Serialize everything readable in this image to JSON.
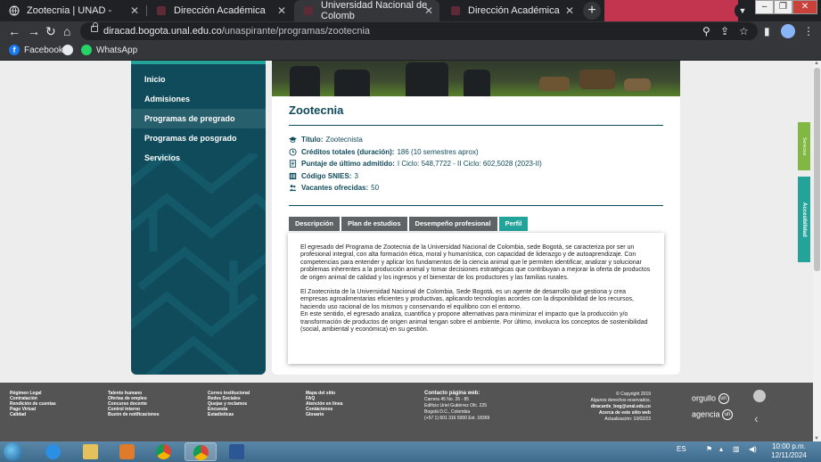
{
  "browser": {
    "tabs": [
      {
        "title": "Zootecnia | UNAD -"
      },
      {
        "title": "Dirección Académica"
      },
      {
        "title": "Universidad Nacional de Colomb"
      },
      {
        "title": "Dirección Académica"
      }
    ],
    "url": {
      "host": "diracad.bogota.unal.edu.co",
      "path": "/unaspirante/programas/zootecnia"
    },
    "bookmarks": [
      {
        "label": "Facebook"
      },
      {
        "label": "WhatsApp"
      }
    ]
  },
  "sidebar": {
    "items": [
      {
        "label": "Inicio"
      },
      {
        "label": "Admisiones"
      },
      {
        "label": "Programas de pregrado",
        "active": true
      },
      {
        "label": "Programas de posgrado"
      },
      {
        "label": "Servicios"
      }
    ]
  },
  "program": {
    "title": "Zootecnia",
    "details": [
      {
        "label": "Título:",
        "value": "Zootecnista",
        "icon": "graduation-cap-icon"
      },
      {
        "label": "Créditos totales (duración):",
        "value": "186 (10 semestres aprox)",
        "icon": "clock-icon"
      },
      {
        "label": "Puntaje de último admitido:",
        "value": "I Ciclo: 548,7722 - II Ciclo: 602,5028 (2023-II)",
        "icon": "document-icon"
      },
      {
        "label": "Código SNIES:",
        "value": "3",
        "icon": "barcode-icon"
      },
      {
        "label": "Vacantes ofrecidas:",
        "value": "50",
        "icon": "people-icon"
      }
    ],
    "tabs": [
      {
        "label": "Descripción"
      },
      {
        "label": "Plan de estudios"
      },
      {
        "label": "Desempeño profesional"
      },
      {
        "label": "Perfil",
        "active": true
      }
    ],
    "profile_paragraphs": [
      "El egresado del Programa de Zootecnia de la Universidad Nacional de Colombia, sede Bogotá, se caracteriza por ser un profesional integral, con alta formación ética, moral y humanística, con capacidad de liderazgo y de autoaprendizaje. Con competencias para entender y aplicar los fundamentos de la ciencia animal que le permiten identificar, analizar y solucionar problemas inherentes a la producción animal y tomar decisiones estratégicas que contribuyan a mejorar la oferta de productos de origen animal de calidad y los ingresos y el bienestar de los productores y las familias rurales.",
      "El Zootecnista de la Universidad Nacional de Colombia, Sede Bogotá, es un agente de desarrollo que gestiona y crea empresas agroalimentarias eficientes y productivas, aplicando tecnologías acordes con la disponibilidad de los recursos, haciendo uso racional de los mismos y conservando el equilibrio con el entorno.",
      "En este sentido, el egresado analiza, cuantifica y propone alternativas para minimizar el impacto que la producción y/o transformación de productos de origen animal tengan sobre el ambiente. Por último, involucra los conceptos de sostenibilidad (social, ambiental y económica) en su gestión."
    ]
  },
  "footer": {
    "col1": [
      "Régimen Legal",
      "Contratación",
      "Rendición de cuentas",
      "Pago Virtual",
      "Calidad"
    ],
    "col2": [
      "Talento humano",
      "Ofertas de empleo",
      "Concurso docente",
      "Control interno",
      "Buzón de notificaciones"
    ],
    "col3": [
      "Correo institucional",
      "Redes Sociales",
      "Quejas y reclamos",
      "Encuesta",
      "Estadísticas"
    ],
    "col4": [
      "Mapa del sitio",
      "FAQ",
      "Atención en línea",
      "Contáctenos",
      "Glosario"
    ],
    "contact": {
      "heading": "Contacto página web:",
      "lines": [
        "Carrera 45 No. 26 - 85",
        "Edificio Uriel Gutiérrez Ofc. 225",
        "Bogotá D.C., Colombia",
        "(+57 1) 601 316 5000 Ext. 18369"
      ]
    },
    "copyright": [
      "© Copyright 2019",
      "Algunos derechos reservados.",
      "diracarde_bog@unal.edu.co",
      "Acerca de este sitio web",
      "Actualización: 10/02/23"
    ],
    "brands": [
      {
        "label": "orgullo",
        "badge": "un"
      },
      {
        "label": "agencia",
        "badge": "un"
      }
    ]
  },
  "side_tabs": {
    "services": "Servicios",
    "accessibility": "Accesibilidad"
  },
  "taskbar": {
    "lang": "ES",
    "time": "10:00 p.m.",
    "date": "12/11/2024"
  },
  "colors": {
    "primary": "#0f4b5b",
    "accent": "#23a39a",
    "tab_inactive": "#5f6366",
    "footer": "#545454"
  }
}
